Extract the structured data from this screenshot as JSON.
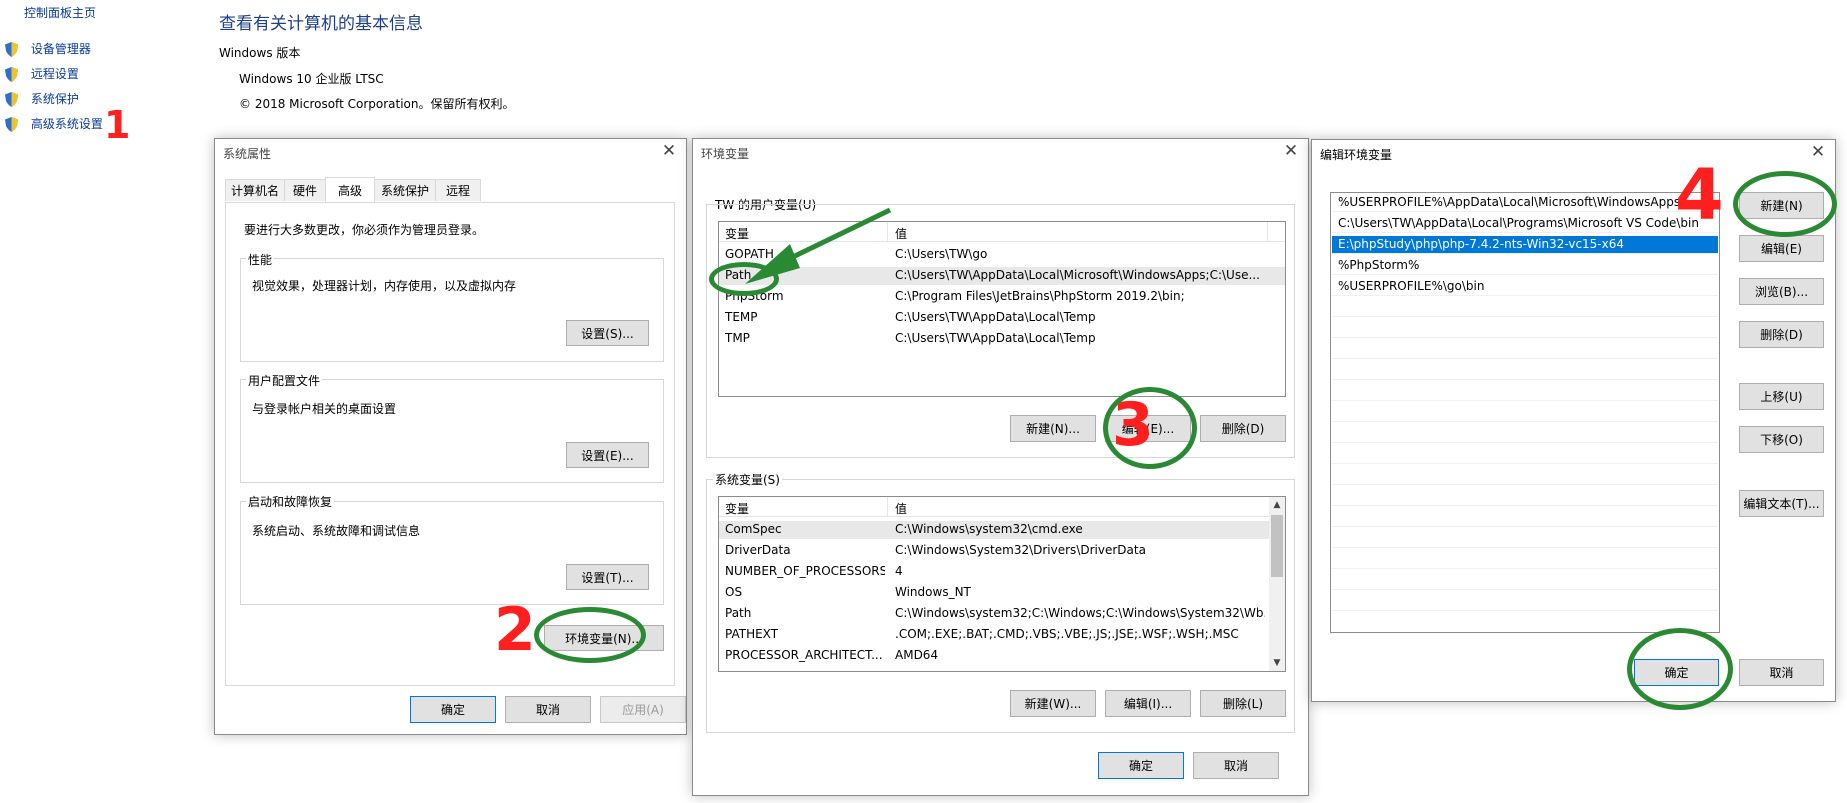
{
  "sidebar": {
    "home": "控制面板主页",
    "items": [
      "设备管理器",
      "远程设置",
      "系统保护",
      "高级系统设置"
    ]
  },
  "main": {
    "heading": "查看有关计算机的基本信息",
    "section": "Windows 版本",
    "edition": "Windows 10 企业版 LTSC",
    "copyright": "© 2018 Microsoft Corporation。保留所有权利。"
  },
  "sysprops": {
    "title": "系统属性",
    "tabs": [
      "计算机名",
      "硬件",
      "高级",
      "系统保护",
      "远程"
    ],
    "active_tab": "高级",
    "admin_note": "要进行大多数更改，你必须作为管理员登录。",
    "groups": [
      {
        "label": "性能",
        "desc": "视觉效果，处理器计划，内存使用，以及虚拟内存",
        "button": "设置(S)..."
      },
      {
        "label": "用户配置文件",
        "desc": "与登录帐户相关的桌面设置",
        "button": "设置(E)..."
      },
      {
        "label": "启动和故障恢复",
        "desc": "系统启动、系统故障和调试信息",
        "button": "设置(T)..."
      }
    ],
    "env_button": "环境变量(N)...",
    "ok": "确定",
    "cancel": "取消",
    "apply": "应用(A)"
  },
  "envvars": {
    "title": "环境变量",
    "user_group": "TW 的用户变量(U)",
    "col_var": "变量",
    "col_val": "值",
    "user_vars": [
      {
        "name": "GOPATH",
        "value": "C:\\Users\\TW\\go"
      },
      {
        "name": "Path",
        "value": "C:\\Users\\TW\\AppData\\Local\\Microsoft\\WindowsApps;C:\\Use..."
      },
      {
        "name": "PhpStorm",
        "value": "C:\\Program Files\\JetBrains\\PhpStorm 2019.2\\bin;"
      },
      {
        "name": "TEMP",
        "value": "C:\\Users\\TW\\AppData\\Local\\Temp"
      },
      {
        "name": "TMP",
        "value": "C:\\Users\\TW\\AppData\\Local\\Temp"
      }
    ],
    "user_buttons": [
      "新建(N)...",
      "编辑(E)...",
      "删除(D)"
    ],
    "system_group": "系统变量(S)",
    "system_vars": [
      {
        "name": "ComSpec",
        "value": "C:\\Windows\\system32\\cmd.exe"
      },
      {
        "name": "DriverData",
        "value": "C:\\Windows\\System32\\Drivers\\DriverData"
      },
      {
        "name": "NUMBER_OF_PROCESSORS",
        "value": "4"
      },
      {
        "name": "OS",
        "value": "Windows_NT"
      },
      {
        "name": "Path",
        "value": "C:\\Windows\\system32;C:\\Windows;C:\\Windows\\System32\\Wb..."
      },
      {
        "name": "PATHEXT",
        "value": ".COM;.EXE;.BAT;.CMD;.VBS;.VBE;.JS;.JSE;.WSF;.WSH;.MSC"
      },
      {
        "name": "PROCESSOR_ARCHITECT...",
        "value": "AMD64"
      }
    ],
    "system_buttons": [
      "新建(W)...",
      "编辑(I)...",
      "删除(L)"
    ],
    "ok": "确定",
    "cancel": "取消"
  },
  "editenv": {
    "title": "编辑环境变量",
    "entries": [
      "%USERPROFILE%\\AppData\\Local\\Microsoft\\WindowsApps",
      "C:\\Users\\TW\\AppData\\Local\\Programs\\Microsoft VS Code\\bin",
      "E:\\phpStudy\\php\\php-7.4.2-nts-Win32-vc15-x64",
      "%PhpStorm%",
      "%USERPROFILE%\\go\\bin"
    ],
    "buttons": [
      "新建(N)",
      "编辑(E)",
      "浏览(B)...",
      "删除(D)",
      "上移(U)",
      "下移(O)",
      "编辑文本(T)..."
    ],
    "ok": "确定",
    "cancel": "取消"
  },
  "annotations": {
    "numbers": [
      "1",
      "2",
      "3",
      "4"
    ],
    "circle_color": "#2a8a34",
    "number_color": "#ff1f1f"
  }
}
